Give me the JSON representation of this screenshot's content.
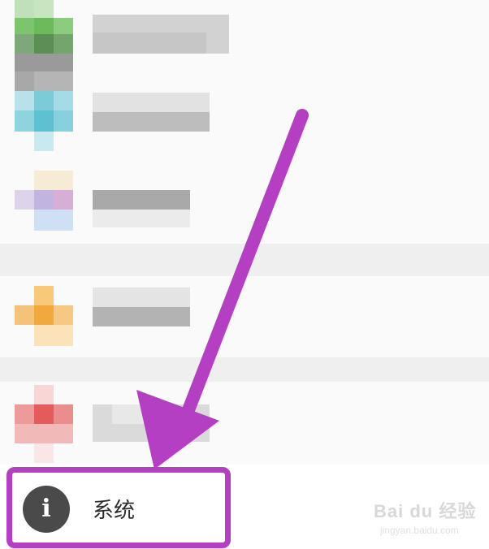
{
  "menu": {
    "system_item": {
      "label": "系统",
      "icon": "info-icon",
      "icon_glyph": "i"
    }
  },
  "annotation": {
    "highlight_color": "#b53fc2",
    "arrow_color": "#b53fc2"
  },
  "watermark": {
    "logo_text": "Bai du 经验",
    "url": "jingyan.baidu.com"
  }
}
